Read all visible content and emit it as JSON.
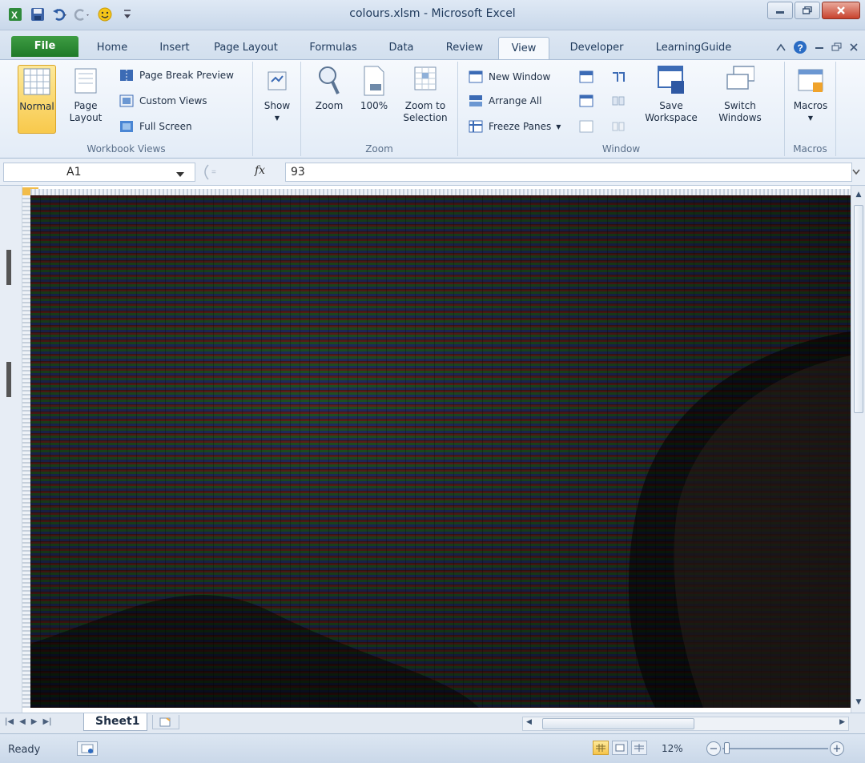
{
  "window": {
    "title": "colours.xlsm  -  Microsoft Excel",
    "minimize_icon": "minimize-icon",
    "restore_icon": "restore-icon",
    "close_icon": "close-icon"
  },
  "quick_access": [
    "excel-logo-icon",
    "save-icon",
    "undo-icon",
    "redo-icon",
    "smiley-macro-icon",
    "customize-qat-icon"
  ],
  "tabs": [
    {
      "label": "File",
      "active": false
    },
    {
      "label": "Home",
      "active": false
    },
    {
      "label": "Insert",
      "active": false
    },
    {
      "label": "Page Layout",
      "active": false
    },
    {
      "label": "Formulas",
      "active": false
    },
    {
      "label": "Data",
      "active": false
    },
    {
      "label": "Review",
      "active": false
    },
    {
      "label": "View",
      "active": true
    },
    {
      "label": "Developer",
      "active": false
    },
    {
      "label": "LearningGuide",
      "active": false
    }
  ],
  "ribbon": {
    "workbook_views": {
      "label": "Workbook Views",
      "normal": "Normal",
      "page_layout": "Page Layout",
      "page_break_preview": "Page Break Preview",
      "custom_views": "Custom Views",
      "full_screen": "Full Screen"
    },
    "show": {
      "label": "Show"
    },
    "zoom": {
      "label": "Zoom",
      "zoom": "Zoom",
      "hundred": "100%",
      "zoom_to_selection": "Zoom to Selection"
    },
    "window": {
      "label": "Window",
      "new_window": "New Window",
      "arrange_all": "Arrange All",
      "freeze_panes": "Freeze Panes",
      "save_workspace": "Save Workspace",
      "switch_windows": "Switch Windows"
    },
    "macros": {
      "label": "Macros",
      "macros": "Macros"
    }
  },
  "formula_bar": {
    "name_box": "A1",
    "fx": "fx",
    "formula": "93"
  },
  "sheets": {
    "tabs": [
      "Sheet1"
    ]
  },
  "status": {
    "ready": "Ready",
    "zoom": "12%",
    "zoom_level": 0.12
  },
  "colors": {
    "file_tab": "#2e8b36",
    "selected_button": "#f8c94c",
    "stripe_red": "#8a2a26",
    "stripe_green": "#2f6b2c",
    "stripe_blue": "#2c3f84"
  }
}
